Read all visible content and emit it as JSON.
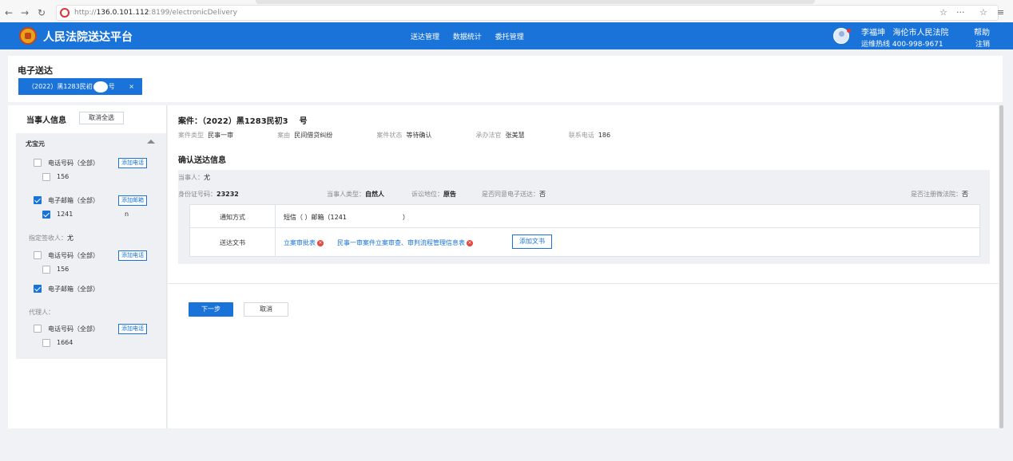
{
  "browser": {
    "url_prefix": "http://",
    "url_host": "136.0.101.112",
    "url_rest": ":8199/electronicDelivery"
  },
  "header": {
    "brand": "人民法院送达平台",
    "nav": [
      "送达管理",
      "数据统计",
      "委托管理"
    ],
    "user_name": "李福坤",
    "court": "海伦市人民法院",
    "help": "帮助",
    "hotline": "运维热线 400-998-9671",
    "logout": "注销"
  },
  "title_panel": {
    "title": "电子送达",
    "case_tab": "（2022）黑1283民初",
    "case_tab_suffix": "号",
    "close": "×"
  },
  "sidebar": {
    "heading": "当事人信息",
    "deselect_all": "取消全选",
    "party_name": "尤宝元",
    "phone_label": "电话号码（全部）",
    "add_phone": "添加电话",
    "phone_value": "156",
    "email_label": "电子邮箱（全部）",
    "add_email": "添加邮箱",
    "email_value": "1241",
    "email_value_end": "n",
    "designee_label": "指定签收人：",
    "designee_name": "尤",
    "designee_phone_label": "电话号码（全部）",
    "designee_add_phone": "添加电话",
    "designee_phone_value": "156",
    "designee_email_label": "电子邮箱（全部）",
    "agent_label": "代理人：",
    "agent_phone_label": "电话号码（全部）",
    "agent_add_phone": "添加电话",
    "agent_phone_value": "1664"
  },
  "main": {
    "case_label": "案件：",
    "case_no": "（2022）黑1283民初3",
    "case_no_suffix": "号",
    "info": {
      "type_k": "案件类型",
      "type_v": "民事一审",
      "cause_k": "案由",
      "cause_v": "民间借贷纠纷",
      "status_k": "案件状态",
      "status_v": "等待确认",
      "judge_k": "承办法官",
      "judge_v": "张美慧",
      "phone_k": "联系电话",
      "phone_v": "186"
    },
    "section_title": "确认送达信息",
    "party_k": "当事人：",
    "party_v": "尤",
    "id_k": "身份证号码：",
    "id_v": "23232",
    "ptype_k": "当事人类型：",
    "ptype_v": "自然人",
    "role_k": "诉讼地位：",
    "role_v": "原告",
    "agree_k": "是否同意电子送达：",
    "agree_v": "否",
    "wechat_k": "是否注册微法院：",
    "wechat_v": "否",
    "method_label": "通知方式",
    "method_value_start": "短信（ ）邮箱（1241",
    "method_value_end": "）",
    "docs_label": "送达文书",
    "doc1": "立案审批表",
    "doc2": "民事一审案件立案审查、审判流程管理信息表",
    "add_doc": "添加文书",
    "next": "下一步",
    "cancel": "取消"
  }
}
